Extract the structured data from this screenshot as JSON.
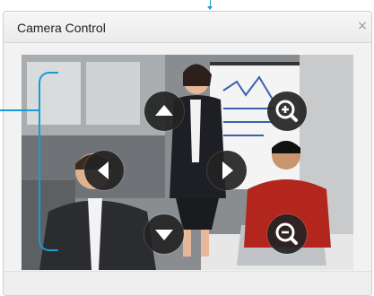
{
  "dialog": {
    "title": "Camera Control",
    "close_icon": "close-icon",
    "close_glyph": "×"
  },
  "video": {
    "description_icon": "camera-feed",
    "controls": [
      {
        "name": "pan-up-button",
        "icon": "triangle-up-icon"
      },
      {
        "name": "pan-left-button",
        "icon": "triangle-left-icon"
      },
      {
        "name": "pan-right-button",
        "icon": "triangle-right-icon"
      },
      {
        "name": "pan-down-button",
        "icon": "triangle-down-icon"
      },
      {
        "name": "zoom-in-button",
        "icon": "zoom-in-icon"
      },
      {
        "name": "zoom-out-button",
        "icon": "zoom-out-icon"
      }
    ]
  },
  "colors": {
    "accent": "#1a9ad6",
    "control_bg": "#232323",
    "control_fg": "#ffffff"
  }
}
